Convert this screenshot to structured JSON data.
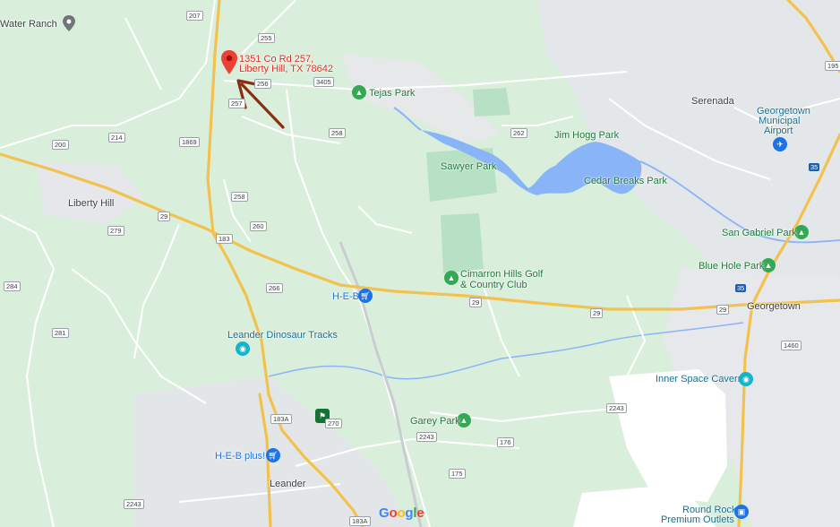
{
  "map": {
    "address_lines": [
      "1351 Co Rd 257,",
      "Liberty Hill, TX 78642"
    ],
    "places": [
      "Water Ranch",
      "Liberty Hill",
      "Serenada",
      "Georgetown",
      "Leander"
    ],
    "parks": [
      "Tejas Park",
      "Jim Hogg Park",
      "Sawyer Park",
      "Cedar Breaks Park",
      "San Gabriel Park",
      "Blue Hole Park",
      "Cimarron Hills Golf",
      "& Country Club",
      "Garey Park"
    ],
    "pois": [
      "Georgetown",
      "Municipal",
      "Airport",
      "Inner Space Cavern",
      "Leander Dinosaur Tracks",
      "Round Rock",
      "Premium Outlets"
    ],
    "stores": [
      "H-E-B",
      "H-E-B plus!"
    ],
    "road_shields": [
      "207",
      "255",
      "256",
      "257",
      "3405",
      "1869",
      "214",
      "200",
      "258",
      "262",
      "279",
      "260",
      "284",
      "266",
      "281",
      "270",
      "2243",
      "176",
      "175",
      "1460",
      "195"
    ],
    "highway_shields": [
      "29",
      "183",
      "183A",
      "35"
    ],
    "attribution": [
      "G",
      "o",
      "o",
      "g",
      "l",
      "e"
    ],
    "colors": {
      "land": "#d9efdc",
      "urban": "#e8eaed",
      "water": "#8ab4f8",
      "highway": "#f2c14e",
      "road": "#ffffff",
      "park": "#b5e0c0",
      "pin": "#ea4335",
      "arrow": "#8b2e0f"
    }
  }
}
